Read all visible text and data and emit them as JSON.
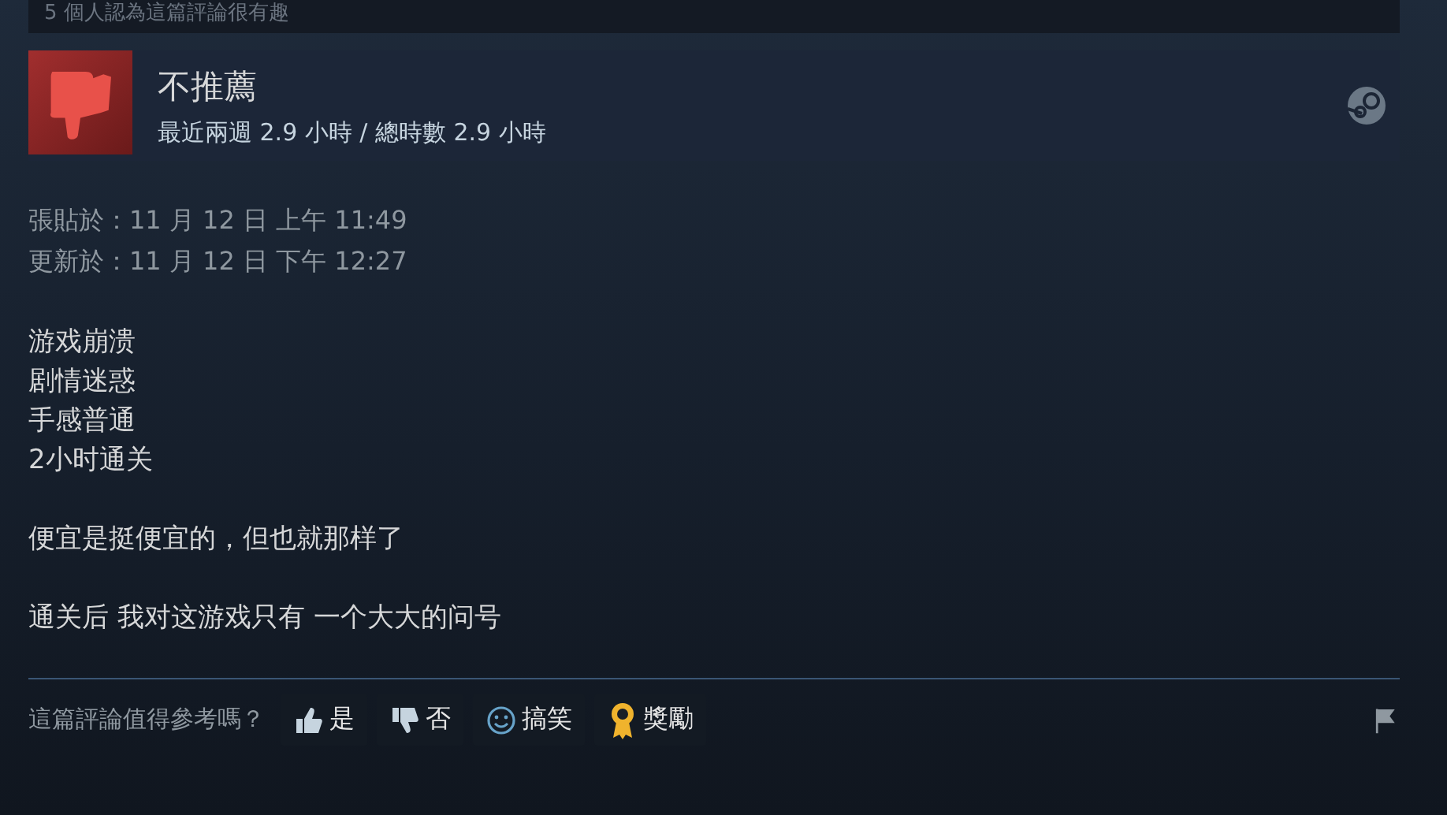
{
  "funny_count": "5 個人認為這篇評論很有趣",
  "review": {
    "verdict": "不推薦",
    "recommended": false,
    "hours": "最近兩週 2.9 小時 / 總時數 2.9 小時"
  },
  "dates": [
    "張貼於：11 月 12 日 上午 11:49",
    "更新於：11 月 12 日 下午 12:27"
  ],
  "paragraphs": [
    [
      "游戏崩溃",
      "剧情迷惑",
      "手感普通",
      "2小时通关"
    ],
    [
      "便宜是挺便宜的，但也就那样了"
    ],
    [
      "通关后 我对这游戏只有 一个大大的问号"
    ]
  ],
  "helpful_prompt": "這篇評論值得參考嗎？",
  "buttons": [
    {
      "kind": "yes",
      "label": "是"
    },
    {
      "kind": "no",
      "label": "否"
    },
    {
      "kind": "funny",
      "label": "搞笑"
    },
    {
      "kind": "award",
      "label": "獎勵"
    }
  ]
}
